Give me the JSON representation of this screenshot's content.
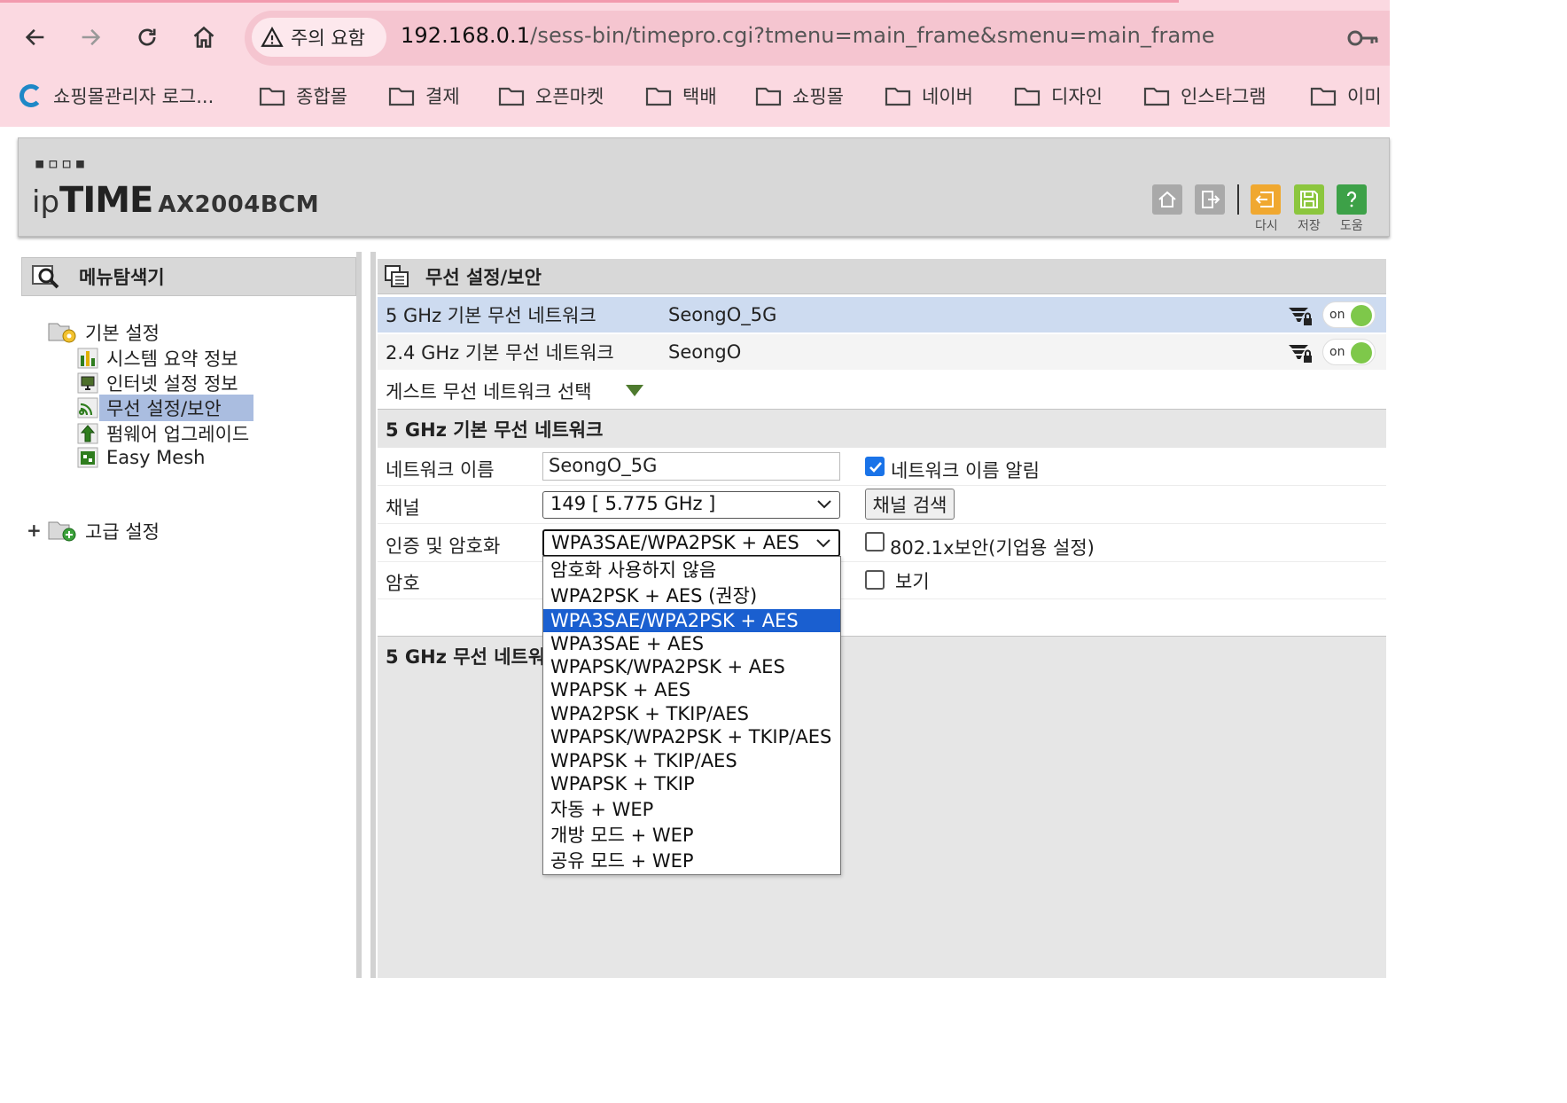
{
  "browser": {
    "warning_chip": "주의 요함",
    "url_host": "192.168.0.1",
    "url_path": "/sess-bin/timepro.cgi?tmenu=main_frame&smenu=main_frame",
    "bookmarks": [
      {
        "label": "쇼핑몰관리자 로그..."
      },
      {
        "label": "종합몰"
      },
      {
        "label": "결제"
      },
      {
        "label": "오픈마켓"
      },
      {
        "label": "택배"
      },
      {
        "label": "쇼핑몰"
      },
      {
        "label": "네이버"
      },
      {
        "label": "디자인"
      },
      {
        "label": "인스타그램"
      },
      {
        "label": "이미"
      }
    ]
  },
  "router": {
    "brand_dots": "▪▫▫▪",
    "brand_ip": "ip",
    "brand_time": "TIME",
    "model": "AX2004BCM",
    "actions": {
      "reload": "다시",
      "save": "저장",
      "help": "도움"
    }
  },
  "menu": {
    "title": "메뉴탐색기",
    "basic": "기본 설정",
    "items": [
      {
        "label": "시스템 요약 정보"
      },
      {
        "label": "인터넷 설정 정보"
      },
      {
        "label": "무선 설정/보안"
      },
      {
        "label": "펌웨어 업그레이드"
      },
      {
        "label": "Easy Mesh"
      }
    ],
    "advanced": "고급 설정"
  },
  "main": {
    "title": "무선 설정/보안",
    "networks": [
      {
        "name": "5 GHz 기본 무선 네트워크",
        "ssid": "SeongO_5G",
        "toggle": "on"
      },
      {
        "name": "2.4 GHz 기본 무선 네트워크",
        "ssid": "SeongO",
        "toggle": "on"
      }
    ],
    "guest_select": "게스트 무선 네트워크 선택",
    "section_title": "5 GHz 기본 무선 네트워크",
    "form": {
      "network_name_label": "네트워크 이름",
      "network_name_value": "SeongO_5G",
      "broadcast_label": "네트워크 이름 알림",
      "channel_label": "채널",
      "channel_value": "149 [ 5.775 GHz ]",
      "channel_scan_button": "채널 검색",
      "auth_label": "인증 및 암호화",
      "auth_value": "WPA3SAE/WPA2PSK + AES",
      "enterprise_label": "802.1x보안(기업용 설정)",
      "password_label": "암호",
      "show_label": "보기"
    },
    "section2_title": "5 GHz 무선 네트워",
    "auth_options": [
      "암호화 사용하지 않음",
      "WPA2PSK + AES (권장)",
      "WPA3SAE/WPA2PSK + AES",
      "WPA3SAE + AES",
      "WPAPSK/WPA2PSK + AES",
      "WPAPSK + AES",
      "WPA2PSK + TKIP/AES",
      "WPAPSK/WPA2PSK + TKIP/AES",
      "WPAPSK + TKIP/AES",
      "WPAPSK + TKIP",
      "자동 + WEP",
      "개방 모드 + WEP",
      "공유 모드 + WEP"
    ],
    "selected_option": "WPA3SAE/WPA2PSK + AES"
  },
  "colors": {
    "chrome_bg": "#fbd9e1",
    "selection": "#1a5fd0",
    "menu_selected": "#aabde0",
    "toggle_on": "#7ec84a"
  }
}
